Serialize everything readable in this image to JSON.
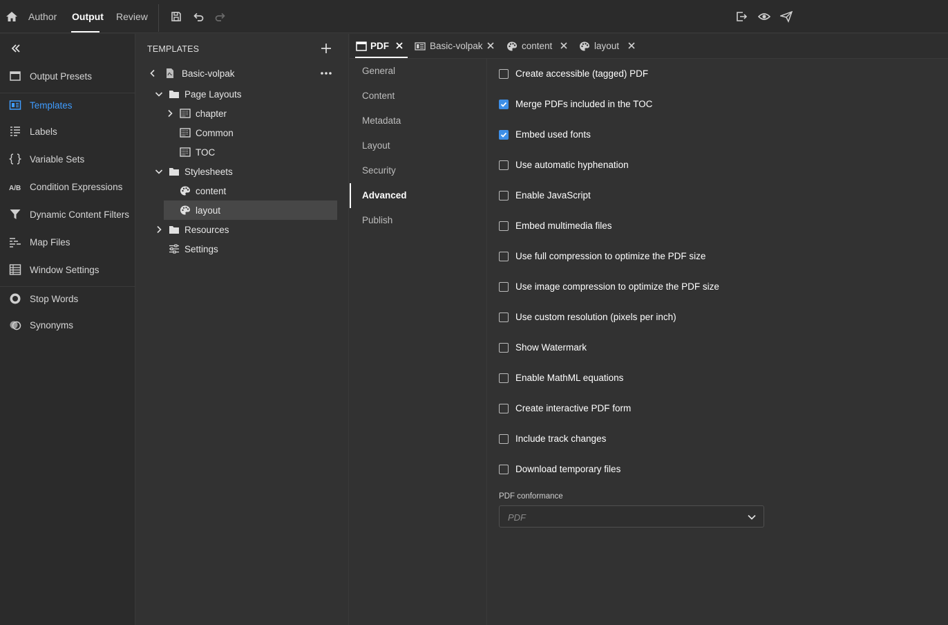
{
  "topbar": {
    "tabs": [
      "Author",
      "Output",
      "Review"
    ],
    "active_tab": "Output"
  },
  "leftnav": {
    "items": [
      {
        "label": "Output Presets",
        "icon": "output-presets-icon"
      },
      {
        "label": "Templates",
        "icon": "templates-icon",
        "active": true
      },
      {
        "label": "Labels",
        "icon": "labels-icon"
      },
      {
        "label": "Variable Sets",
        "icon": "braces-icon"
      },
      {
        "label": "Condition Expressions",
        "icon": "ab-icon"
      },
      {
        "label": "Dynamic Content Filters",
        "icon": "filter-icon"
      },
      {
        "label": "Map Files",
        "icon": "map-files-icon"
      },
      {
        "label": "Window Settings",
        "icon": "table-icon"
      },
      {
        "label": "Stop Words",
        "icon": "stop-icon"
      },
      {
        "label": "Synonyms",
        "icon": "synonyms-icon"
      }
    ],
    "ab_text": "A/B"
  },
  "templates": {
    "title": "TEMPLATES",
    "tree": [
      {
        "label": "Basic-volpak",
        "icon": "pdf-file-icon"
      },
      {
        "label": "Page Layouts",
        "icon": "folder-icon"
      },
      {
        "label": "chapter",
        "icon": "page-layout-icon"
      },
      {
        "label": "Common",
        "icon": "page-layout-icon"
      },
      {
        "label": "TOC",
        "icon": "page-layout-icon"
      },
      {
        "label": "Stylesheets",
        "icon": "folder-icon"
      },
      {
        "label": "content",
        "icon": "palette-icon"
      },
      {
        "label": "layout",
        "icon": "palette-icon",
        "selected": true
      },
      {
        "label": "Resources",
        "icon": "folder-icon"
      },
      {
        "label": "Settings",
        "icon": "settings-sliders-icon"
      }
    ]
  },
  "tabs": [
    {
      "label": "PDF",
      "icon": "window-icon",
      "active": true
    },
    {
      "label": "Basic-volpak",
      "icon": "template-icon"
    },
    {
      "label": "content",
      "icon": "palette-icon"
    },
    {
      "label": "layout",
      "icon": "palette-icon"
    }
  ],
  "categories": [
    "General",
    "Content",
    "Metadata",
    "Layout",
    "Security",
    "Advanced",
    "Publish"
  ],
  "active_category": "Advanced",
  "options": [
    {
      "label": "Create accessible (tagged) PDF",
      "checked": false
    },
    {
      "label": "Merge PDFs included in the TOC",
      "checked": true
    },
    {
      "label": "Embed used fonts",
      "checked": true
    },
    {
      "label": "Use automatic hyphenation",
      "checked": false
    },
    {
      "label": "Enable JavaScript",
      "checked": false
    },
    {
      "label": "Embed multimedia files",
      "checked": false
    },
    {
      "label": "Use full compression to optimize the PDF size",
      "checked": false
    },
    {
      "label": "Use image compression to optimize the PDF size",
      "checked": false
    },
    {
      "label": "Use custom resolution (pixels per inch)",
      "checked": false
    },
    {
      "label": "Show Watermark",
      "checked": false
    },
    {
      "label": "Enable MathML equations",
      "checked": false
    },
    {
      "label": "Create interactive PDF form",
      "checked": false
    },
    {
      "label": "Include track changes",
      "checked": false
    },
    {
      "label": "Download temporary files",
      "checked": false
    }
  ],
  "conformance": {
    "label": "PDF conformance",
    "placeholder": "PDF"
  },
  "colors": {
    "accent": "#3d8fe8",
    "nav_active": "#3f9cff",
    "background": "#323232"
  }
}
